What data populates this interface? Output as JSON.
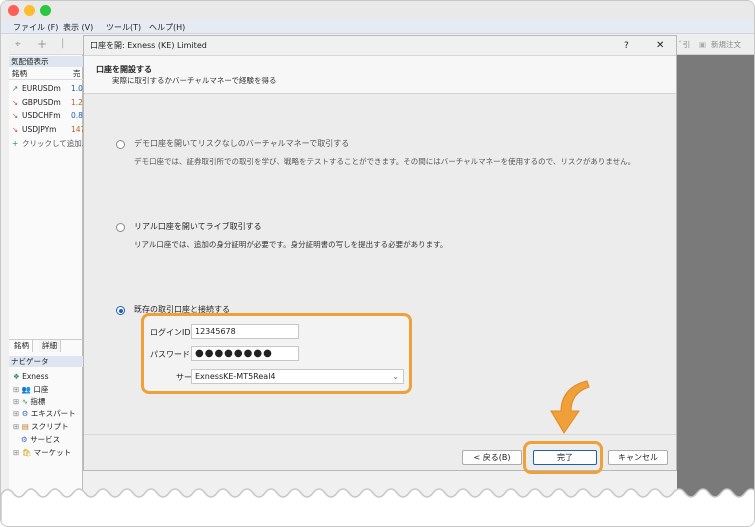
{
  "menu": [
    "ファイル (F)",
    "表示 (V)",
    "ツール(T)",
    "ヘルプ(H)"
  ],
  "toolbar": {
    "right_partial": "ﾞ引",
    "new_order": "新規注文"
  },
  "market_watch": {
    "title": "気配値表示",
    "col_symbol": "銘柄",
    "col_bid": "売",
    "rows": [
      {
        "symbol": "EURUSDm",
        "value": "1.0",
        "dir": "up"
      },
      {
        "symbol": "GBPUSDm",
        "value": "1.2",
        "dir": "down"
      },
      {
        "symbol": "USDCHFm",
        "value": "0.8",
        "dir": "down"
      },
      {
        "symbol": "USDJPYm",
        "value": "147",
        "dir": "down"
      }
    ],
    "add_label": "クリックして追加..."
  },
  "left_tabs": [
    "銘柄",
    "詳細"
  ],
  "navigator": {
    "title": "ナビゲータ",
    "root": "Exness",
    "items": [
      "口座",
      "指標",
      "エキスパート",
      "スクリプト",
      "サービス",
      "マーケット"
    ]
  },
  "dialog": {
    "title": "口座を開: Exness (KE) Limited",
    "help": "?",
    "close": "✕",
    "header_title": "口座を開設する",
    "header_subtitle": "実際に取引するかバーチャルマネーで経験を得る",
    "options": [
      {
        "title": "デモ口座を開いてリスクなしのバーチャルマネーで取引する",
        "desc": "デモ口座では、証券取引所での取引を学び、戦略をテストすることができます。その間にはバーチャルマネーを使用するので、リスクがありません。",
        "selected": false
      },
      {
        "title": "リアル口座を開いてライブ取引する",
        "desc": "リアル口座では、追加の身分証明が必要です。身分証明書の写しを提出する必要があります。",
        "selected": false
      },
      {
        "title": "既存の取引口座と接続する",
        "desc": "",
        "selected": true
      }
    ],
    "login": {
      "login_label": "ログインID:",
      "login_value": "12345678",
      "password_label": "パスワード:",
      "password_value": "●●●●●●●●",
      "server_label": "サーバ:",
      "server_value": "ExnessKE-MT5Real4"
    },
    "buttons": {
      "back": "< 戻る(B)",
      "finish": "完了",
      "cancel": "キャンセル"
    }
  },
  "colors": {
    "highlight": "#f0a038",
    "accent": "#1d5fb8"
  }
}
